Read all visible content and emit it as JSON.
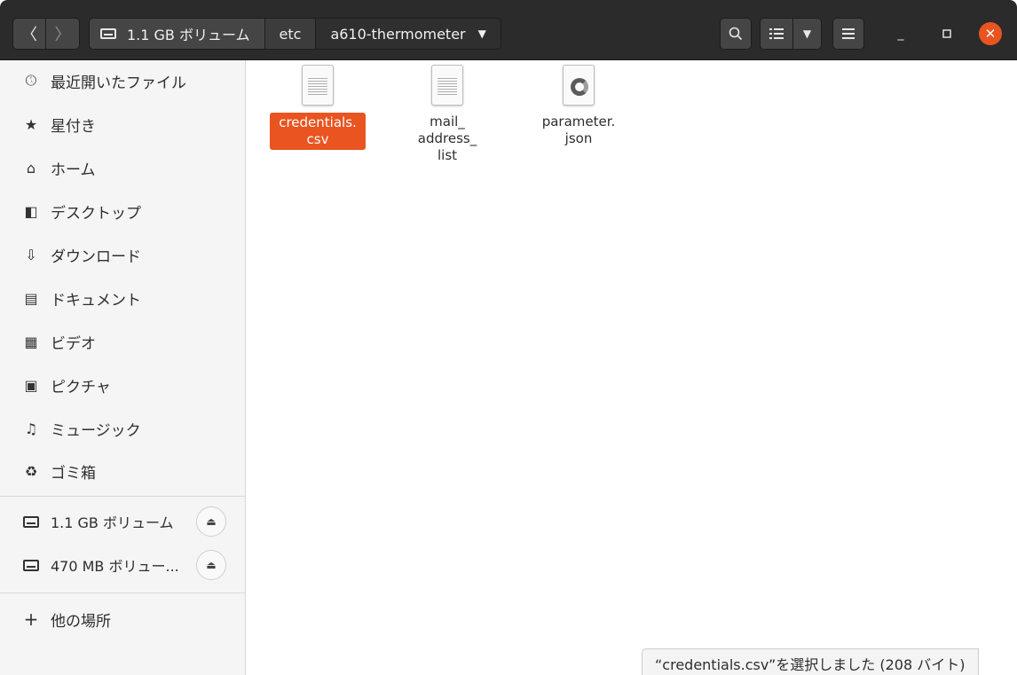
{
  "header": {
    "back_icon": "chevron-left-icon",
    "forward_icon": "chevron-right-icon",
    "path": [
      {
        "label": "1.1 GB ボリューム",
        "icon": "drive-icon"
      },
      {
        "label": "etc"
      },
      {
        "label": "a610-thermometer",
        "icon": "caret-down-icon"
      }
    ],
    "tools": {
      "search_icon": "search-icon",
      "view_icon": "list-view-icon",
      "menu_icon": "hamburger-menu-icon"
    },
    "window": {
      "minimize": "minimize-icon",
      "maximize": "maximize-icon",
      "close": "close-icon"
    }
  },
  "sidebar": {
    "places": [
      {
        "label": "最近開いたファイル",
        "icon": "clock-icon"
      },
      {
        "label": "星付き",
        "icon": "star-icon"
      },
      {
        "label": "ホーム",
        "icon": "home-icon"
      },
      {
        "label": "デスクトップ",
        "icon": "desktop-icon"
      },
      {
        "label": "ダウンロード",
        "icon": "download-icon"
      },
      {
        "label": "ドキュメント",
        "icon": "document-icon"
      },
      {
        "label": "ビデオ",
        "icon": "video-icon"
      },
      {
        "label": "ピクチャ",
        "icon": "picture-icon"
      },
      {
        "label": "ミュージック",
        "icon": "music-icon"
      },
      {
        "label": "ゴミ箱",
        "icon": "trash-icon"
      }
    ],
    "volumes": [
      {
        "label": "1.1 GB ボリューム",
        "icon": "drive-icon",
        "eject_icon": "eject-icon"
      },
      {
        "label": "470 MB ボリュー...",
        "icon": "drive-icon",
        "eject_icon": "eject-icon"
      }
    ],
    "other": {
      "label": "他の場所",
      "icon": "plus-icon"
    }
  },
  "files": [
    {
      "name": "credentials.\ncsv",
      "icon": "text-file-icon",
      "selected": true
    },
    {
      "name": "mail_\naddress_\nlist",
      "icon": "text-file-icon",
      "selected": false
    },
    {
      "name": "parameter.\njson",
      "icon": "json-file-icon",
      "selected": false
    }
  ],
  "status": {
    "text": "“credentials.csv”を選択しました (208 バイト)"
  }
}
